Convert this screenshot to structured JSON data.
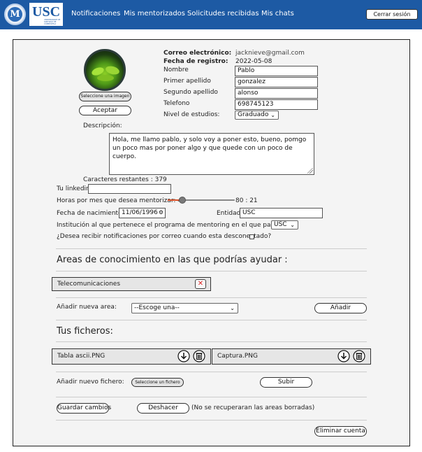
{
  "nav": {
    "logo_letter": "M",
    "university_abbr": "USC",
    "university_tagline": "UNIVERSIDADE DE SANTIAGO DE COMPOSTELA",
    "links": [
      "Notificaciones",
      "Mis mentorizados",
      "Solicitudes recibidas",
      "Mis chats"
    ],
    "logout_label": "Cerrar sesión"
  },
  "profile": {
    "select_image_label": "Seleccione una imagen",
    "accept_label": "Aceptar",
    "email_label": "Correo electrónico:",
    "email_value": "jacknieve@gmail.com",
    "registration_label": "Fecha de registro:",
    "registration_value": "2022-05-08",
    "name_label": "Nombre",
    "name_value": "Pablo",
    "first_surname_label": "Primer apellido",
    "first_surname_value": "gonzalez",
    "second_surname_label": "Segundo apellido",
    "second_surname_value": "alonso",
    "phone_label": "Telefono",
    "phone_value": "698745123",
    "education_label": "Nivel de estudios:",
    "education_value": "Graduado",
    "description_label": "Descripción:",
    "description_value": "Hola, me llamo pablo, y solo voy a poner esto, bueno, pomgo un poco mas por poner algo y que quede con un poco de cuerpo.",
    "chars_remaining": "Caracteres restantes : 379",
    "linkedin_label": "Tu linkedin",
    "linkedin_value": "",
    "hours_label": "Horas por mes que desea mentorizar: 4",
    "hours_max_text": "80 : 21",
    "hours_value": 21,
    "hours_min": 4,
    "hours_max": 80,
    "birth_label": "Fecha de nacimiento:",
    "birth_value": "11/06/1996",
    "entity_label": "Entidad",
    "entity_value": "USC",
    "institution_label": "Institución al que pertenece el programa de mentoring en el que participas:",
    "institution_value": "USC",
    "notify_label": "¿Desea recibir notificaciones por correo cuando esta desconectado?",
    "notify_checked": false
  },
  "areas": {
    "title": "Areas de conocimiento en las que podrías ayudar :",
    "items": [
      "Telecomunicaciones"
    ],
    "add_label": "Añadir nueva area:",
    "select_placeholder": "--Escoge una--",
    "add_button": "Añadir"
  },
  "files": {
    "title": "Tus ficheros:",
    "items": [
      "Tabla ascii.PNG",
      "Captura.PNG"
    ],
    "add_label": "Añadir nuevo fichero:",
    "select_file_button": "Seleccione un fichero",
    "upload_button": "Subir"
  },
  "actions": {
    "save": "Guardar cambios",
    "undo": "Deshacer",
    "undo_note": "(No se recuperaran las areas borradas)",
    "delete_account": "Eliminar cuenta"
  },
  "colors": {
    "nav_bg": "#1d5aa4",
    "card_bg": "#f4f4f4",
    "slider_fill": "#d9532b",
    "remove_icon": "#dd2222"
  },
  "icons": [
    "download-icon",
    "trash-icon",
    "close-icon",
    "calendar-icon",
    "chevron-down-icon"
  ]
}
